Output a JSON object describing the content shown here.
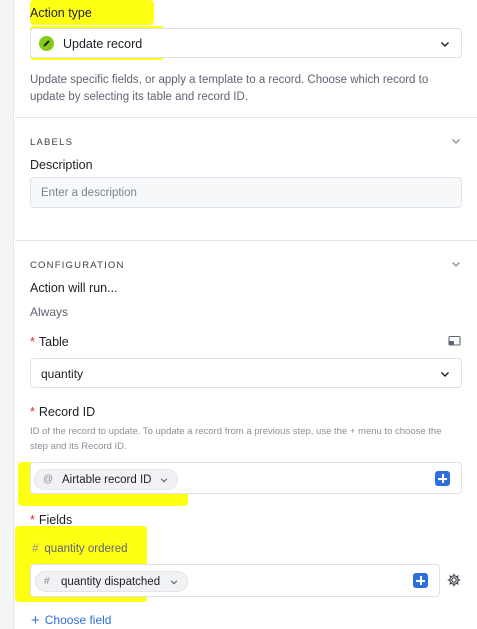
{
  "action_type": {
    "label": "Action type",
    "selected": "Update record",
    "description": "Update specific fields, or apply a template to a record. Choose which record to update by selecting its table and record ID."
  },
  "labels_section": {
    "title": "LABELS",
    "description_label": "Description",
    "description_placeholder": "Enter a description"
  },
  "configuration_section": {
    "title": "CONFIGURATION",
    "run_label": "Action will run...",
    "run_value": "Always",
    "table_required_mark": "*",
    "table_label": "Table",
    "table_value": "quantity",
    "record_required_mark": "*",
    "record_label": "Record ID",
    "record_help": "ID of the record to update. To update a record from a previous step, use the + menu to choose the step and its Record ID.",
    "record_token_icon": "@",
    "record_token": "Airtable record ID",
    "fields_required_mark": "*",
    "fields_label": "Fields",
    "field_icon": "#",
    "field_1": "quantity ordered",
    "field_2_icon": "#",
    "field_2": "quantity dispatched",
    "choose_field_plus": "+",
    "choose_field": "Choose field"
  },
  "colors": {
    "highlight": "#ffff14",
    "accent_blue": "#2d6fdb",
    "required": "#d92d20",
    "pencil_badge": "#84cc16"
  },
  "icons": [
    "pencil-icon",
    "chevron-down-icon",
    "expand-icon",
    "plus-icon",
    "gear-icon",
    "hash-icon",
    "at-icon"
  ]
}
